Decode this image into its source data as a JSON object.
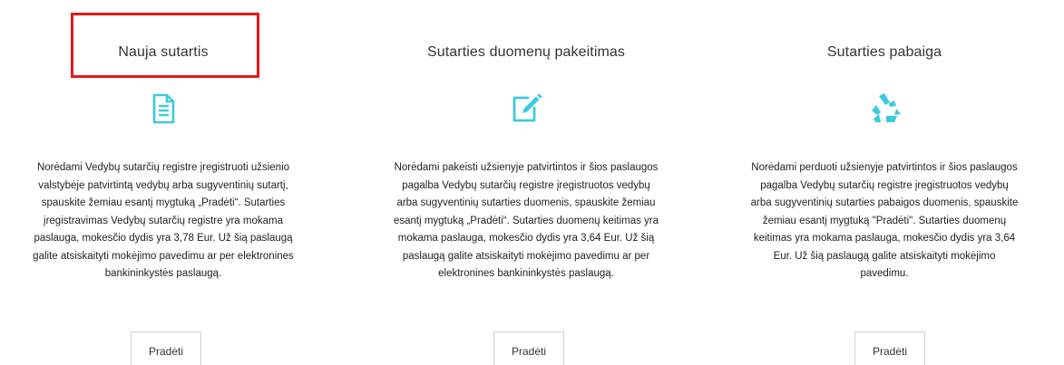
{
  "colors": {
    "accent": "#3ec9dc",
    "highlight": "#e31a1a"
  },
  "services": [
    {
      "title": "Nauja sutartis",
      "icon": "document-icon",
      "description_lines": [
        "Norėdami Vedybų sutarčių registre įregistruoti užsienio",
        "valstybėje patvirtintą vedybų arba sugyventinių sutartį,",
        "spauskite žemiau esantį mygtuką „Pradėti“. Sutarties",
        "įregistravimas Vedybų sutarčių registre yra mokama",
        "paslauga, mokesčio dydis yra 3,78 Eur. Už šią paslaugą",
        "galite atsiskaityti mokėjimo pavedimu ar per elektronines",
        "bankininkystės paslaugą."
      ],
      "button_label": "Pradėti"
    },
    {
      "title": "Sutarties duomenų pakeitimas",
      "icon": "edit-icon",
      "description_lines": [
        "Norėdami pakeisti užsienyje patvirtintos ir šios paslaugos",
        "pagalba Vedybų sutarčių registre įregistruotos vedybų",
        "arba sugyventinių sutarties duomenis, spauskite žemiau",
        "esantį mygtuką „Pradėti“. Sutarties duomenų keitimas yra",
        "mokama paslauga, mokesčio dydis yra 3,64 Eur. Už šią",
        "paslaugą galite atsiskaityti mokėjimo pavedimu ar per",
        "elektronines bankininkystės paslaugą."
      ],
      "button_label": "Pradėti"
    },
    {
      "title": "Sutarties pabaiga",
      "icon": "recycle-icon",
      "description_lines": [
        "Norėdami perduoti užsienyje patvirtintos ir šios paslaugos",
        "pagalba Vedybų sutarčių registre įregistruotos vedybų",
        "arba sugyventinių sutarties pabaigos duomenis, spauskite",
        "žemiau esantį mygtuką \"Pradėti\". Sutarties duomenų",
        "keitimas yra mokama paslauga, mokesčio dydis yra 3,64",
        "Eur. Už šią paslaugą galite atsiskaityti mokėjimo",
        "pavedimu."
      ],
      "button_label": "Pradėti"
    }
  ]
}
